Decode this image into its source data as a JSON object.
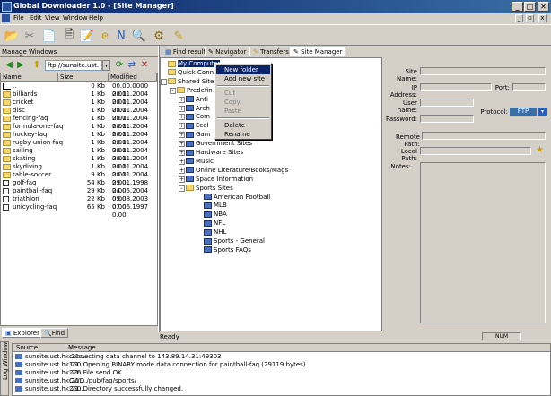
{
  "window": {
    "title": "Global Downloader 1.0 - [Site Manager]",
    "min": "_",
    "max": "□",
    "close": "✕"
  },
  "menu": [
    "File",
    "Edit",
    "View",
    "Window",
    "Help"
  ],
  "mdi": {
    "min": "_",
    "restore": "▫",
    "close": "x"
  },
  "toolbar": [
    {
      "name": "open-icon",
      "glyph": "📂"
    },
    {
      "name": "tools-icon",
      "glyph": "✂"
    },
    {
      "name": "copy-icon",
      "glyph": "📄"
    },
    {
      "name": "document-icon",
      "glyph": "🗎"
    },
    {
      "name": "notes-icon",
      "glyph": "📝"
    },
    {
      "name": "internet-explorer-icon",
      "glyph": "e"
    },
    {
      "name": "netscape-icon",
      "glyph": "N"
    },
    {
      "name": "search-icon",
      "glyph": "🔍"
    },
    {
      "name": "ftp-icon",
      "glyph": "⚙"
    },
    {
      "name": "edit-icon",
      "glyph": "✎"
    }
  ],
  "left": {
    "header": "Manage Windows",
    "address": "ftp://sunsite.ust.",
    "columns": [
      "Name",
      "Size",
      "Modified"
    ],
    "files": [
      {
        "name": "..",
        "size": "0 Kb",
        "mod": "00.00.0000 0.00",
        "type": "up"
      },
      {
        "name": "billiards",
        "size": "1 Kb",
        "mod": "20.11.2004 0.00",
        "type": "folder"
      },
      {
        "name": "cricket",
        "size": "1 Kb",
        "mod": "20.11.2004 0.00",
        "type": "folder"
      },
      {
        "name": "disc",
        "size": "1 Kb",
        "mod": "20.11.2004 0.00",
        "type": "folder"
      },
      {
        "name": "fencing-faq",
        "size": "1 Kb",
        "mod": "20.11.2004 0.00",
        "type": "folder"
      },
      {
        "name": "formula-one-faq",
        "size": "1 Kb",
        "mod": "20.11.2004 0.00",
        "type": "folder"
      },
      {
        "name": "hockey-faq",
        "size": "1 Kb",
        "mod": "20.11.2004 0.00",
        "type": "folder"
      },
      {
        "name": "rugby-union-faq",
        "size": "1 Kb",
        "mod": "20.11.2004 0.00",
        "type": "folder"
      },
      {
        "name": "sailing",
        "size": "1 Kb",
        "mod": "20.11.2004 0.00",
        "type": "folder"
      },
      {
        "name": "skating",
        "size": "1 Kb",
        "mod": "20.11.2004 0.00",
        "type": "folder"
      },
      {
        "name": "skydiving",
        "size": "1 Kb",
        "mod": "20.11.2004 0.00",
        "type": "folder"
      },
      {
        "name": "table-soccer",
        "size": "9 Kb",
        "mod": "20.11.2004 0.00",
        "type": "folder"
      },
      {
        "name": "golf-faq",
        "size": "54 Kb",
        "mod": "29.01.1998 0.00",
        "type": "doc"
      },
      {
        "name": "paintball-faq",
        "size": "29 Kb",
        "mod": "24.05.2004 0.00",
        "type": "doc"
      },
      {
        "name": "triathlon",
        "size": "22 Kb",
        "mod": "09.08.2003 0.00",
        "type": "doc"
      },
      {
        "name": "unicycling-faq",
        "size": "65 Kb",
        "mod": "07.06.1997 0.00",
        "type": "doc"
      }
    ],
    "tabs": [
      "Explorer",
      "Find"
    ]
  },
  "tabs": [
    "Find result",
    "Navigator",
    "Transfers",
    "Site Manager"
  ],
  "tree": [
    {
      "label": "My Computer",
      "depth": 0,
      "icon": "folder",
      "selected": true
    },
    {
      "label": "Quick Conne",
      "depth": 0,
      "icon": "folder"
    },
    {
      "label": "Shared Sites",
      "depth": 0,
      "icon": "folder",
      "expander": "-"
    },
    {
      "label": "Predefin",
      "depth": 1,
      "icon": "folder",
      "expander": "-"
    },
    {
      "label": "Anti",
      "depth": 2,
      "icon": "site",
      "expander": "+"
    },
    {
      "label": "Arch",
      "depth": 2,
      "icon": "site",
      "expander": "+"
    },
    {
      "label": "Com",
      "depth": 2,
      "icon": "site",
      "expander": "+"
    },
    {
      "label": "Ecol",
      "depth": 2,
      "icon": "site",
      "expander": "+"
    },
    {
      "label": "Gam",
      "depth": 2,
      "icon": "site",
      "expander": "+"
    },
    {
      "label": "Government Sites",
      "depth": 2,
      "icon": "site",
      "expander": "+"
    },
    {
      "label": "Hardware Sites",
      "depth": 2,
      "icon": "site",
      "expander": "+"
    },
    {
      "label": "Music",
      "depth": 2,
      "icon": "site",
      "expander": "+"
    },
    {
      "label": "Online Literature/Books/Mags",
      "depth": 2,
      "icon": "site",
      "expander": "+"
    },
    {
      "label": "Space Information",
      "depth": 2,
      "icon": "site",
      "expander": "+"
    },
    {
      "label": "Sports Sites",
      "depth": 2,
      "icon": "folder",
      "expander": "-"
    },
    {
      "label": "American Football",
      "depth": 3,
      "icon": "site"
    },
    {
      "label": "MLB",
      "depth": 3,
      "icon": "site"
    },
    {
      "label": "NBA",
      "depth": 3,
      "icon": "site"
    },
    {
      "label": "NFL",
      "depth": 3,
      "icon": "site"
    },
    {
      "label": "NHL",
      "depth": 3,
      "icon": "site"
    },
    {
      "label": "Sports - General",
      "depth": 3,
      "icon": "site"
    },
    {
      "label": "Sports FAQs",
      "depth": 3,
      "icon": "site"
    }
  ],
  "context_menu": [
    {
      "label": "New folder",
      "state": "selected"
    },
    {
      "label": "Add new site",
      "state": "normal"
    },
    {
      "label": "",
      "state": "sep"
    },
    {
      "label": "Cut",
      "state": "disabled"
    },
    {
      "label": "Copy",
      "state": "disabled"
    },
    {
      "label": "Paste",
      "state": "disabled"
    },
    {
      "label": "",
      "state": "sep"
    },
    {
      "label": "Delete",
      "state": "normal"
    },
    {
      "label": "Rename",
      "state": "normal"
    }
  ],
  "form": {
    "site_name": "Site Name:",
    "ip": "IP Address:",
    "port": "Port:",
    "user": "User name:",
    "protocol": "Protocol:",
    "protocol_value": "FTP",
    "password": "Password:",
    "remote": "Remote Path:",
    "local": "Local Path:",
    "notes": "Notes:"
  },
  "status": {
    "text": "Ready",
    "num": "NUM"
  },
  "log": {
    "side": "Log Window",
    "columns": [
      "Source",
      "Message"
    ],
    "rows": [
      {
        "src": "sunsite.ust.hk:21:...",
        "msg": "connecting data channel to 143.89.14.31:49303"
      },
      {
        "src": "sunsite.ust.hk:21:...",
        "msg": "150 Opening BINARY mode data connection for paintball-faq (29119 bytes)."
      },
      {
        "src": "sunsite.ust.hk:21:...",
        "msg": "226 File send OK."
      },
      {
        "src": "sunsite.ust.hk:21:...",
        "msg": "CWD /pub/faq/sports/"
      },
      {
        "src": "sunsite.ust.hk:21:...",
        "msg": "250 Directory successfully changed."
      }
    ]
  }
}
